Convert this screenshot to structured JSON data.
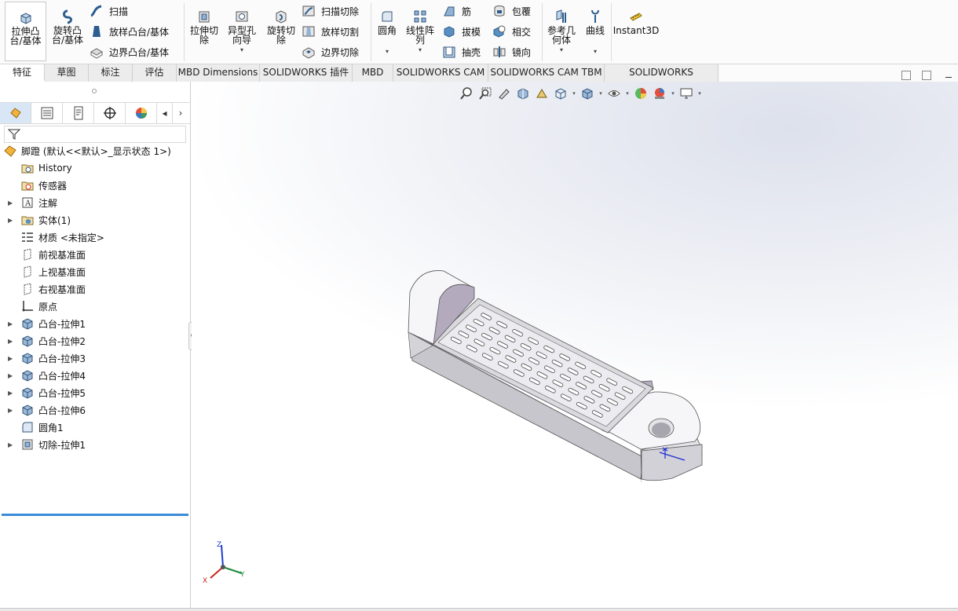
{
  "ribbon": {
    "extrude_boss": "拉伸凸\n台/基体",
    "revolve_boss": "旋转凸\n台/基体",
    "sweep": "扫描",
    "loft_boss": "放样凸台/基体",
    "boundary_boss": "边界凸台/基体",
    "extrude_cut": "拉伸切\n除",
    "hole_wizard": "异型孔\n向导",
    "revolve_cut": "旋转切\n除",
    "swept_cut": "扫描切除",
    "lofted_cut": "放样切割",
    "boundary_cut": "边界切除",
    "fillet": "圆角",
    "linear_pattern": "线性阵\n列",
    "rib": "筋",
    "draft": "拔模",
    "shell": "抽壳",
    "wrap": "包覆",
    "intersect": "相交",
    "mirror": "镜向",
    "ref_geometry": "参考几\n何体",
    "curves": "曲线",
    "instant3d": "Instant3D",
    "dropdown_glyph": "▾"
  },
  "tabs": [
    "特征",
    "草图",
    "标注",
    "评估",
    "MBD Dimensions",
    "SOLIDWORKS 插件",
    "MBD",
    "SOLIDWORKS CAM",
    "SOLIDWORKS CAM TBM",
    "SOLIDWORKS Inspection"
  ],
  "panel": {
    "scroll_left": "◂",
    "scroll_right": "›",
    "root": "脚蹬 (默认<<默认>_显示状态 1>)",
    "items": [
      {
        "label": "History",
        "icon": "history-folder-icon"
      },
      {
        "label": "传感器",
        "icon": "sensors-folder-icon"
      },
      {
        "label": "注解",
        "icon": "annotations-icon"
      },
      {
        "label": "实体(1)",
        "icon": "solid-bodies-icon"
      },
      {
        "label": "材质 <未指定>",
        "icon": "material-icon"
      },
      {
        "label": "前视基准面",
        "icon": "plane-icon"
      },
      {
        "label": "上视基准面",
        "icon": "plane-icon"
      },
      {
        "label": "右视基准面",
        "icon": "plane-icon"
      },
      {
        "label": "原点",
        "icon": "origin-icon"
      },
      {
        "label": "凸台-拉伸1",
        "icon": "extrude-feature-icon"
      },
      {
        "label": "凸台-拉伸2",
        "icon": "extrude-feature-icon"
      },
      {
        "label": "凸台-拉伸3",
        "icon": "extrude-feature-icon"
      },
      {
        "label": "凸台-拉伸4",
        "icon": "extrude-feature-icon"
      },
      {
        "label": "凸台-拉伸5",
        "icon": "extrude-feature-icon"
      },
      {
        "label": "凸台-拉伸6",
        "icon": "extrude-feature-icon"
      },
      {
        "label": "圆角1",
        "icon": "fillet-feature-icon"
      },
      {
        "label": "切除-拉伸1",
        "icon": "cut-extrude-feature-icon"
      }
    ],
    "expand_glyph": "▶"
  },
  "triad": {
    "x": "X",
    "y": "Y",
    "z": "Z"
  },
  "colors": {
    "accent": "#3a8bd8",
    "part_face": "#f4f4f6",
    "part_side": "#c9c9cf",
    "part_dark": "#8d8a95",
    "slot_face": "#b8aec1"
  }
}
